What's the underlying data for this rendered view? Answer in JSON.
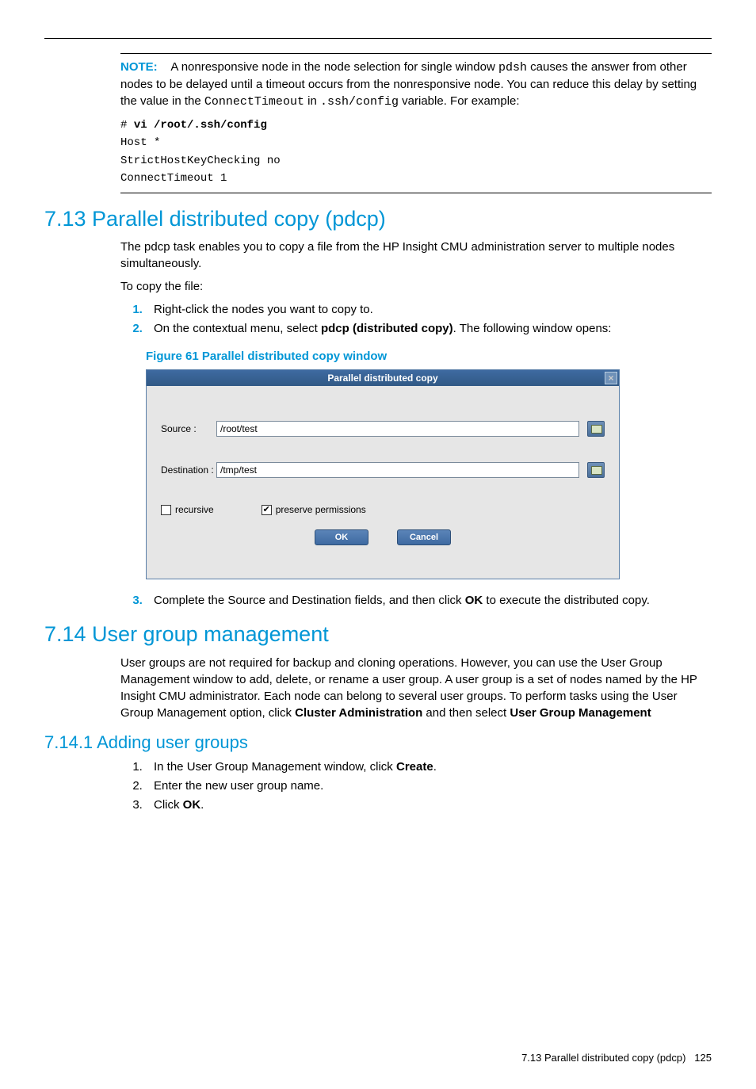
{
  "note": {
    "label": "NOTE:",
    "text_run1": "A nonresponsive node in the node selection for single window ",
    "code1": "pdsh",
    "text_run2": " causes the answer from other nodes to be delayed until a timeout occurs from the nonresponsive node. You can reduce this delay by setting the value in the ",
    "code2": "ConnectTimeout",
    "text_run3": " in ",
    "code3": ".ssh/config",
    "text_run4": " variable. For example:"
  },
  "codeblock": {
    "prompt": "# ",
    "cmd": "vi /root/.ssh/config",
    "line1": "Host *",
    "line2": "StrictHostKeyChecking no",
    "line3": "ConnectTimeout 1"
  },
  "sec713": {
    "heading": "7.13 Parallel distributed copy (pdcp)",
    "para1": "The pdcp task enables you to copy a file from the HP Insight CMU administration server to multiple nodes simultaneously.",
    "para2": "To copy the file:",
    "step1": "Right-click the nodes you want to copy to.",
    "step2_a": "On the contextual menu, select ",
    "step2_b": "pdcp (distributed copy)",
    "step2_c": ". The following window opens:",
    "fig_caption": "Figure 61 Parallel distributed copy window",
    "step3_a": "Complete the Source and Destination fields, and then click ",
    "step3_b": "OK",
    "step3_c": " to execute the distributed copy."
  },
  "dialog": {
    "title": "Parallel distributed copy",
    "source_label": "Source :",
    "source_value": "/root/test",
    "dest_label": "Destination :",
    "dest_value": "/tmp/test",
    "chk_recursive": "recursive",
    "chk_preserve": "preserve permissions",
    "recursive_checked": false,
    "preserve_checked": true,
    "ok": "OK",
    "cancel": "Cancel"
  },
  "sec714": {
    "heading": "7.14 User group management",
    "para_a": "User groups are not required for backup and cloning operations. However, you can use the User Group Management window to add, delete, or rename a user group. A user group is a set of nodes named by the HP Insight CMU administrator. Each node can belong to several user groups. To perform tasks using the User Group Management option, click ",
    "para_b": "Cluster Administration",
    "para_c": " and then select ",
    "para_d": "User Group Management"
  },
  "sec7141": {
    "heading": "7.14.1 Adding user groups",
    "step1_a": "In the User Group Management window, click ",
    "step1_b": "Create",
    "step1_c": ".",
    "step2": "Enter the new user group name.",
    "step3_a": "Click ",
    "step3_b": "OK",
    "step3_c": "."
  },
  "footer": {
    "section": "7.13 Parallel distributed copy (pdcp)",
    "page": "125"
  }
}
